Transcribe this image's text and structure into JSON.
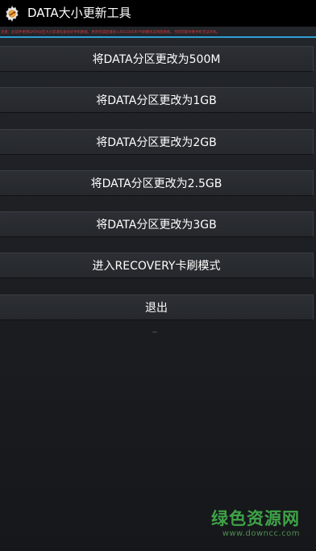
{
  "app": {
    "title": "DATA大小更新工具",
    "icon": "gear-wrench-icon"
  },
  "notice": "注意：此软件更改DATA分区大小前请先备份好手机数据，更改完成后请进入RECOVERY卡刷模式双清后刷机，否则可能导致手机无法开机。",
  "buttons": [
    {
      "label": "将DATA分区更改为500M"
    },
    {
      "label": "将DATA分区更改为1GB"
    },
    {
      "label": "将DATA分区更改为2GB"
    },
    {
      "label": "将DATA分区更改为2.5GB"
    },
    {
      "label": "将DATA分区更改为3GB"
    },
    {
      "label": "进入RECOVERY卡刷模式"
    },
    {
      "label": "退出"
    }
  ],
  "status_text": "--",
  "watermark": {
    "main": "绿色资源网",
    "sub": "www.downcc.com"
  },
  "colors": {
    "accent_divider": "#2f9fd4",
    "notice_text": "#d23a3a",
    "watermark_green": "#3fa348"
  }
}
